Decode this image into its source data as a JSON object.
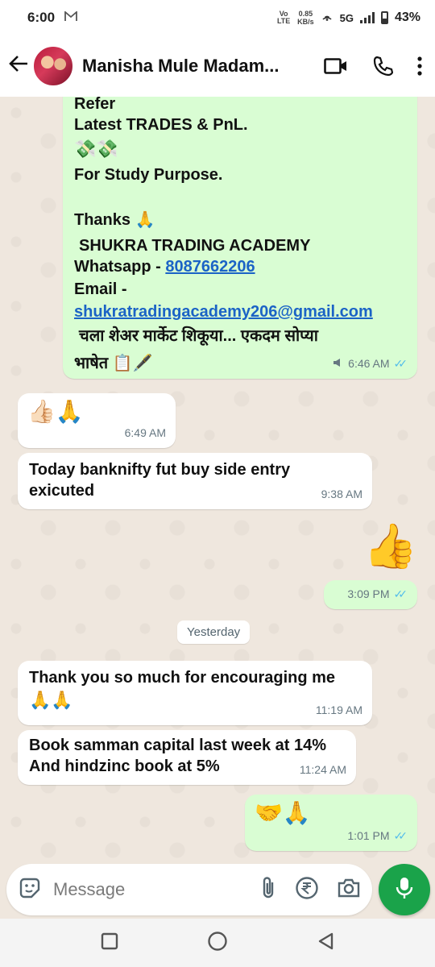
{
  "status": {
    "time": "6:00",
    "mail_icon": "gmail-icon",
    "volte": "Vo LTE",
    "speed_value": "0.85",
    "speed_unit": "KB/s",
    "network": "5G",
    "battery": "43%"
  },
  "header": {
    "contact_name": "Manisha Mule Madam...",
    "icons": [
      "back-arrow-icon",
      "video-call-icon",
      "voice-call-icon",
      "more-vert-icon"
    ]
  },
  "messages": [
    {
      "direction": "outgoing",
      "lines": {
        "refer": "Refer",
        "latest": "Latest TRADES & PnL.",
        "money": "💸💸",
        "study": "For Study Purpose.",
        "thanks": "Thanks 🙏",
        "academy": "SHUKRA TRADING ACADEMY",
        "whatsapp_label": "Whatsapp - ",
        "whatsapp_number": "8087662206",
        "email_label": "Email -",
        "email": "shukratradingacademy206@gmail.com",
        "marathi_1": "चला शेअर मार्केट शिकूया... एकदम सोप्या",
        "marathi_2": "भाषेत 📋🖋️"
      },
      "time": "6:46 AM"
    },
    {
      "direction": "incoming",
      "text": "👍🏻🙏",
      "time": "6:49 AM"
    },
    {
      "direction": "incoming",
      "text": "Today banknifty fut buy side entry exicuted",
      "time": "9:38 AM"
    },
    {
      "direction": "outgoing",
      "text": "👍",
      "time": "3:09 PM"
    },
    {
      "direction": "incoming",
      "text": "Thank you so much for encouraging me",
      "text2": "🙏🙏",
      "time": "11:19 AM"
    },
    {
      "direction": "incoming",
      "text": "Book samman capital last week at 14%",
      "text2": "And hindzinc book at 5%",
      "time": "11:24 AM"
    },
    {
      "direction": "outgoing",
      "text": "🤝🙏",
      "time": "1:01 PM"
    }
  ],
  "date_chip": "Yesterday",
  "ticks": "✓✓",
  "composer": {
    "placeholder": "Message",
    "icons": [
      "sticker-icon",
      "attach-icon",
      "rupee-icon",
      "camera-icon",
      "mic-icon"
    ]
  },
  "navbar": [
    "recents-icon",
    "home-icon",
    "back-icon"
  ],
  "colors": {
    "outgoing_bubble": "#d9fdd3",
    "incoming_bubble": "#ffffff",
    "accent": "#1aa34a",
    "tick_blue": "#53bdeb"
  }
}
